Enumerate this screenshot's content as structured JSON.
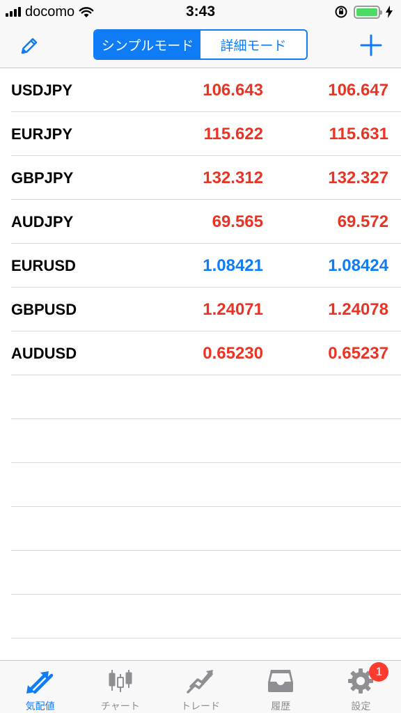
{
  "status_bar": {
    "carrier": "docomo",
    "time": "3:43"
  },
  "nav": {
    "segments": [
      {
        "label": "シンプルモード",
        "selected": true
      },
      {
        "label": "詳細モード",
        "selected": false
      }
    ]
  },
  "quotes": [
    {
      "symbol": "USDJPY",
      "bid": "106.643",
      "ask": "106.647",
      "direction": "up"
    },
    {
      "symbol": "EURJPY",
      "bid": "115.622",
      "ask": "115.631",
      "direction": "up"
    },
    {
      "symbol": "GBPJPY",
      "bid": "132.312",
      "ask": "132.327",
      "direction": "up"
    },
    {
      "symbol": "AUDJPY",
      "bid": "69.565",
      "ask": "69.572",
      "direction": "up"
    },
    {
      "symbol": "EURUSD",
      "bid": "1.08421",
      "ask": "1.08424",
      "direction": "down"
    },
    {
      "symbol": "GBPUSD",
      "bid": "1.24071",
      "ask": "1.24078",
      "direction": "up"
    },
    {
      "symbol": "AUDUSD",
      "bid": "0.65230",
      "ask": "0.65237",
      "direction": "up"
    }
  ],
  "tabs": [
    {
      "label": "気配値",
      "icon": "quotes-arrows-icon",
      "active": true
    },
    {
      "label": "チャート",
      "icon": "candlestick-chart-icon",
      "active": false
    },
    {
      "label": "トレード",
      "icon": "trade-trend-icon",
      "active": false
    },
    {
      "label": "履歴",
      "icon": "history-tray-icon",
      "active": false
    },
    {
      "label": "設定",
      "icon": "gear-icon",
      "active": false,
      "badge": "1"
    }
  ],
  "colors": {
    "accent": "#0f7cf6",
    "price_up": "#e93323",
    "price_down": "#0f7cf6",
    "badge": "#ff3b30",
    "inactive_icon": "#8e8e93"
  }
}
